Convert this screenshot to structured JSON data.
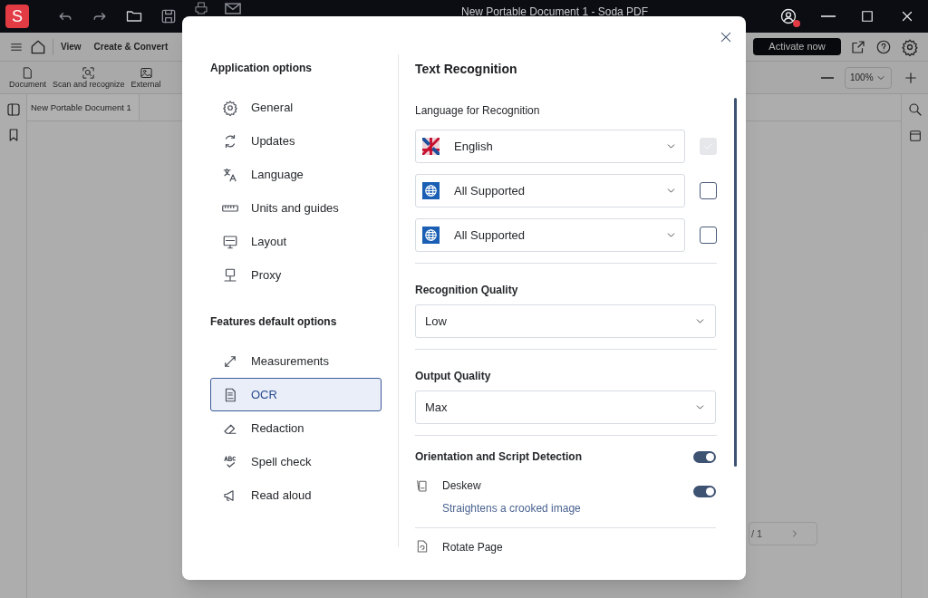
{
  "app": {
    "logo": "S",
    "title": "New Portable Document 1  -  Soda PDF",
    "menu": [
      "View",
      "Create & Convert"
    ],
    "tools": [
      "Document",
      "Scan and recognize",
      "External"
    ],
    "activate": "Activate now",
    "zoom": "100%",
    "doc_tab": "New Portable Document 1",
    "page_indicator": "/ 1"
  },
  "dialog": {
    "groups": [
      {
        "heading": "Application options",
        "items": [
          {
            "label": "General",
            "selected": false
          },
          {
            "label": "Updates",
            "selected": false
          },
          {
            "label": "Language",
            "selected": false
          },
          {
            "label": "Units and guides",
            "selected": false
          },
          {
            "label": "Layout",
            "selected": false
          },
          {
            "label": "Proxy",
            "selected": false
          }
        ]
      },
      {
        "heading": "Features default options",
        "items": [
          {
            "label": "Measurements",
            "selected": false
          },
          {
            "label": "OCR",
            "selected": true
          },
          {
            "label": "Redaction",
            "selected": false
          },
          {
            "label": "Spell check",
            "selected": false
          },
          {
            "label": "Read aloud",
            "selected": false
          }
        ]
      }
    ],
    "section_title": "Text Recognition",
    "language_label": "Language for Recognition",
    "languages": [
      {
        "value": "English",
        "kind": "flag",
        "checked": true,
        "disabled": true
      },
      {
        "value": "All Supported",
        "kind": "globe",
        "checked": false,
        "disabled": false
      },
      {
        "value": "All Supported",
        "kind": "globe",
        "checked": false,
        "disabled": false
      }
    ],
    "qualities": [
      {
        "label": "Recognition Quality",
        "value": "Low"
      },
      {
        "label": "Output Quality",
        "value": "Max"
      }
    ],
    "toggles": [
      {
        "label": "Orientation and Script Detection",
        "on": true
      },
      {
        "label": "Deskew",
        "description": "Straightens a crooked image",
        "on": true
      }
    ],
    "next_item": {
      "label": "Rotate Page"
    }
  }
}
